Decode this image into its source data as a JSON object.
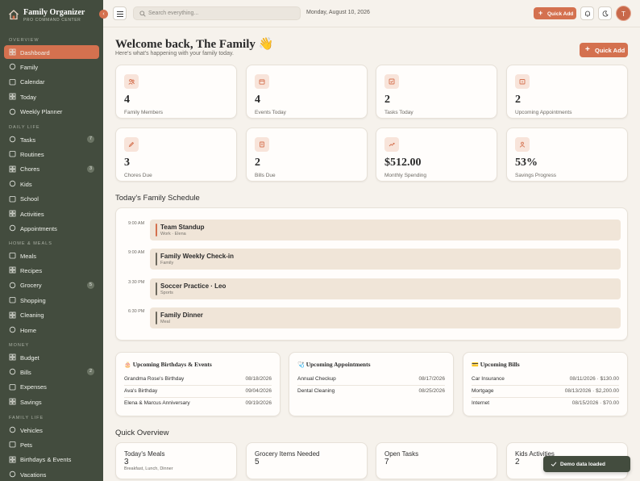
{
  "brand": {
    "title": "Family Organizer",
    "subtitle": "PRO COMMAND CENTER"
  },
  "sidebar": {
    "sections": [
      {
        "label": "OVERVIEW",
        "items": [
          {
            "label": "Dashboard",
            "icon": "dashboard-icon",
            "active": true
          },
          {
            "label": "Family",
            "icon": "family-icon"
          },
          {
            "label": "Calendar",
            "icon": "calendar-icon"
          },
          {
            "label": "Today",
            "icon": "today-icon"
          },
          {
            "label": "Weekly Planner",
            "icon": "planner-icon"
          }
        ]
      },
      {
        "label": "DAILY LIFE",
        "items": [
          {
            "label": "Tasks",
            "icon": "tasks-icon",
            "badge": "7"
          },
          {
            "label": "Routines",
            "icon": "routines-icon"
          },
          {
            "label": "Chores",
            "icon": "chores-icon",
            "badge": "3"
          },
          {
            "label": "Kids",
            "icon": "kids-icon"
          },
          {
            "label": "School",
            "icon": "school-icon"
          },
          {
            "label": "Activities",
            "icon": "activities-icon"
          },
          {
            "label": "Appointments",
            "icon": "appointments-icon"
          }
        ]
      },
      {
        "label": "HOME & MEALS",
        "items": [
          {
            "label": "Meals",
            "icon": "meals-icon"
          },
          {
            "label": "Recipes",
            "icon": "recipes-icon"
          },
          {
            "label": "Grocery",
            "icon": "grocery-icon",
            "badge": "5"
          },
          {
            "label": "Shopping",
            "icon": "shopping-icon"
          },
          {
            "label": "Cleaning",
            "icon": "cleaning-icon"
          },
          {
            "label": "Home",
            "icon": "home-icon"
          }
        ]
      },
      {
        "label": "MONEY",
        "items": [
          {
            "label": "Budget",
            "icon": "budget-icon"
          },
          {
            "label": "Bills",
            "icon": "bills-icon",
            "badge": "2"
          },
          {
            "label": "Expenses",
            "icon": "expenses-icon"
          },
          {
            "label": "Savings",
            "icon": "savings-icon"
          }
        ]
      },
      {
        "label": "FAMILY LIFE",
        "items": [
          {
            "label": "Vehicles",
            "icon": "vehicles-icon"
          },
          {
            "label": "Pets",
            "icon": "pets-icon"
          },
          {
            "label": "Birthdays & Events",
            "icon": "birthdays-icon"
          },
          {
            "label": "Vacations",
            "icon": "vacations-icon"
          }
        ]
      }
    ]
  },
  "topbar": {
    "search_placeholder": "Search everything...",
    "date": "Monday, August 10, 2026",
    "quick_add": "Quick Add",
    "avatar_initial": "T"
  },
  "welcome": {
    "title": "Welcome back, The Family 👋",
    "subtitle": "Here's what's happening with your family today.",
    "quick_add": "Quick Add"
  },
  "stats": [
    {
      "value": "4",
      "label": "Family Members",
      "icon": "users-icon"
    },
    {
      "value": "4",
      "label": "Events Today",
      "icon": "calendar-icon"
    },
    {
      "value": "2",
      "label": "Tasks Today",
      "icon": "checkbox-icon"
    },
    {
      "value": "2",
      "label": "Upcoming Appointments",
      "icon": "appointment-icon"
    },
    {
      "value": "3",
      "label": "Chores Due",
      "icon": "pencil-icon"
    },
    {
      "value": "2",
      "label": "Bills Due",
      "icon": "receipt-icon"
    },
    {
      "value": "$512.00",
      "label": "Monthly Spending",
      "icon": "trend-up-icon"
    },
    {
      "value": "53%",
      "label": "Savings Progress",
      "icon": "piggy-icon"
    }
  ],
  "schedule": {
    "title": "Today's Family Schedule",
    "events": [
      {
        "time": "9:00 AM",
        "title": "Team Standup",
        "meta": "Work · Elena",
        "color": "#d4714f"
      },
      {
        "time": "9:00 AM",
        "title": "Family Weekly Check-in",
        "meta": "Family",
        "color": "#6e6a5f"
      },
      {
        "time": "3:30 PM",
        "title": "Soccer Practice · Leo",
        "meta": "Sports",
        "color": "#6e6a5f"
      },
      {
        "time": "6:30 PM",
        "title": "Family Dinner",
        "meta": "Meal",
        "color": "#6e6a5f"
      }
    ]
  },
  "lists": [
    {
      "emoji": "🎂",
      "title": "Upcoming Birthdays & Events",
      "rows": [
        {
          "name": "Grandma Rose's Birthday",
          "value": "08/18/2026"
        },
        {
          "name": "Ava's Birthday",
          "value": "09/04/2026"
        },
        {
          "name": "Elena & Marcus Anniversary",
          "value": "09/19/2026"
        }
      ]
    },
    {
      "emoji": "🩺",
      "title": "Upcoming Appointments",
      "rows": [
        {
          "name": "Annual Checkup",
          "value": "08/17/2026"
        },
        {
          "name": "Dental Cleaning",
          "value": "08/25/2026"
        }
      ]
    },
    {
      "emoji": "💳",
      "title": "Upcoming Bills",
      "rows": [
        {
          "name": "Car Insurance",
          "value": "08/11/2026 · $130.00"
        },
        {
          "name": "Mortgage",
          "value": "08/13/2026 · $2,200.00"
        },
        {
          "name": "Internet",
          "value": "08/15/2026 · $70.00"
        }
      ]
    }
  ],
  "overview": {
    "title": "Quick Overview",
    "cards": [
      {
        "title": "Today's Meals",
        "value": "3",
        "sub": "Breakfast, Lunch, Dinner"
      },
      {
        "title": "Grocery Items Needed",
        "value": "5",
        "sub": ""
      },
      {
        "title": "Open Tasks",
        "value": "7",
        "sub": ""
      },
      {
        "title": "Kids Activities",
        "value": "2",
        "sub": ""
      }
    ]
  },
  "toast": {
    "label": "Demo data loaded"
  },
  "colors": {
    "accent": "#d4714f",
    "sidebar": "#434c3e",
    "background": "#f6f2ec"
  }
}
